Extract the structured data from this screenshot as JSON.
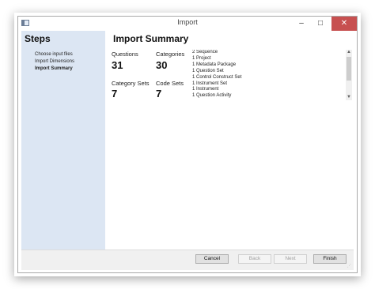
{
  "window": {
    "title": "Import",
    "minimize": "–",
    "maximize": "□",
    "close": "✕"
  },
  "sidebar": {
    "heading": "Steps",
    "items": [
      {
        "label": "Choose input files",
        "active": false
      },
      {
        "label": "Import Dimensions",
        "active": false
      },
      {
        "label": "Import Summary",
        "active": true
      }
    ]
  },
  "summary": {
    "title": "Import Summary",
    "stats": {
      "questions": {
        "label": "Questions",
        "value": "31"
      },
      "categories": {
        "label": "Categories",
        "value": "30"
      },
      "category_sets": {
        "label": "Category Sets",
        "value": "7"
      },
      "code_sets": {
        "label": "Code Sets",
        "value": "7"
      }
    },
    "lines": [
      "2 Sequence",
      "1 Project",
      "1 Metadata Package",
      "1 Question Set",
      "1 Control Construct Set",
      "1 Instrument Set",
      "1 Instrument",
      "1 Question Activity"
    ]
  },
  "scrollbar": {
    "up": "▲",
    "down": "▼"
  },
  "buttons": {
    "cancel": "Cancel",
    "back": "Back",
    "next": "Next",
    "finish": "Finish"
  },
  "colors": {
    "sidebar_bg": "#dce6f3",
    "close_button": "#c75050"
  }
}
